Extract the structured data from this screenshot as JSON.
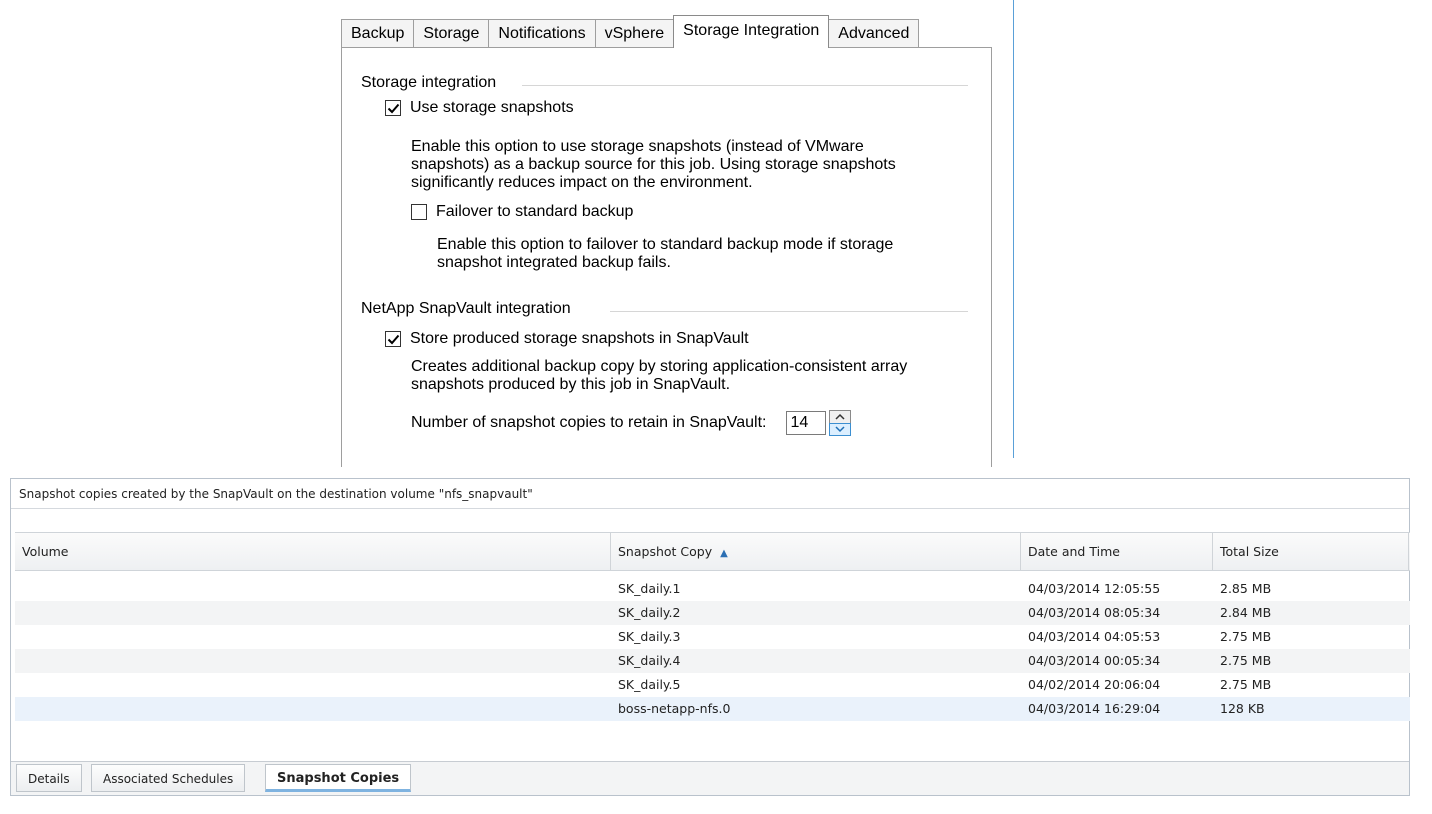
{
  "dialog": {
    "tabs": [
      {
        "label": "Backup",
        "active": false
      },
      {
        "label": "Storage",
        "active": false
      },
      {
        "label": "Notifications",
        "active": false
      },
      {
        "label": "vSphere",
        "active": false
      },
      {
        "label": "Storage Integration",
        "active": true
      },
      {
        "label": "Advanced",
        "active": false
      }
    ],
    "storage_group_title": "Storage integration",
    "use_snapshots": {
      "label": "Use storage snapshots",
      "checked": true,
      "desc_lines": [
        "Enable this option to use storage snapshots (instead of VMware",
        "snapshots) as a backup source for this job. Using storage snapshots",
        "significantly reduces impact on the environment."
      ]
    },
    "failover": {
      "label": "Failover to standard backup",
      "checked": false,
      "desc_lines": [
        "Enable this option to failover to standard backup mode if storage",
        "snapshot integrated backup fails."
      ]
    },
    "snapvault_group_title": "NetApp SnapVault integration",
    "store_snapvault": {
      "label": "Store produced storage snapshots in SnapVault",
      "checked": true,
      "desc_lines": [
        "Creates additional backup copy by storing application-consistent array",
        "snapshots produced by this job in SnapVault."
      ]
    },
    "retain": {
      "label": "Number of snapshot copies to retain in SnapVault:",
      "value": "14"
    }
  },
  "panel": {
    "caption": "Snapshot copies created by the SnapVault on the destination volume \"nfs_snapvault\"",
    "columns": {
      "volume": "Volume",
      "snapshot": "Snapshot Copy",
      "sort_indicator": "▲",
      "datetime": "Date and Time",
      "size": "Total Size"
    },
    "rows": [
      {
        "volume": "",
        "snapshot": "SK_daily.1",
        "datetime": "04/03/2014 12:05:55",
        "size": "2.85 MB"
      },
      {
        "volume": "",
        "snapshot": "SK_daily.2",
        "datetime": "04/03/2014 08:05:34",
        "size": "2.84 MB"
      },
      {
        "volume": "",
        "snapshot": "SK_daily.3",
        "datetime": "04/03/2014 04:05:53",
        "size": "2.75 MB"
      },
      {
        "volume": "",
        "snapshot": "SK_daily.4",
        "datetime": "04/03/2014 00:05:34",
        "size": "2.75 MB"
      },
      {
        "volume": "",
        "snapshot": "SK_daily.5",
        "datetime": "04/02/2014 20:06:04",
        "size": "2.75 MB"
      },
      {
        "volume": "",
        "snapshot": "boss-netapp-nfs.0",
        "datetime": "04/03/2014 16:29:04",
        "size": "128 KB"
      }
    ],
    "bottom_tabs": [
      {
        "label": "Details",
        "active": false
      },
      {
        "label": "Associated Schedules",
        "active": false
      },
      {
        "label": "Snapshot Copies",
        "active": true
      }
    ]
  },
  "colors": {
    "accent": "#5aa0d8",
    "selected_row": "#eaf2fb",
    "active_tab_underline": "#7fb3e0"
  }
}
